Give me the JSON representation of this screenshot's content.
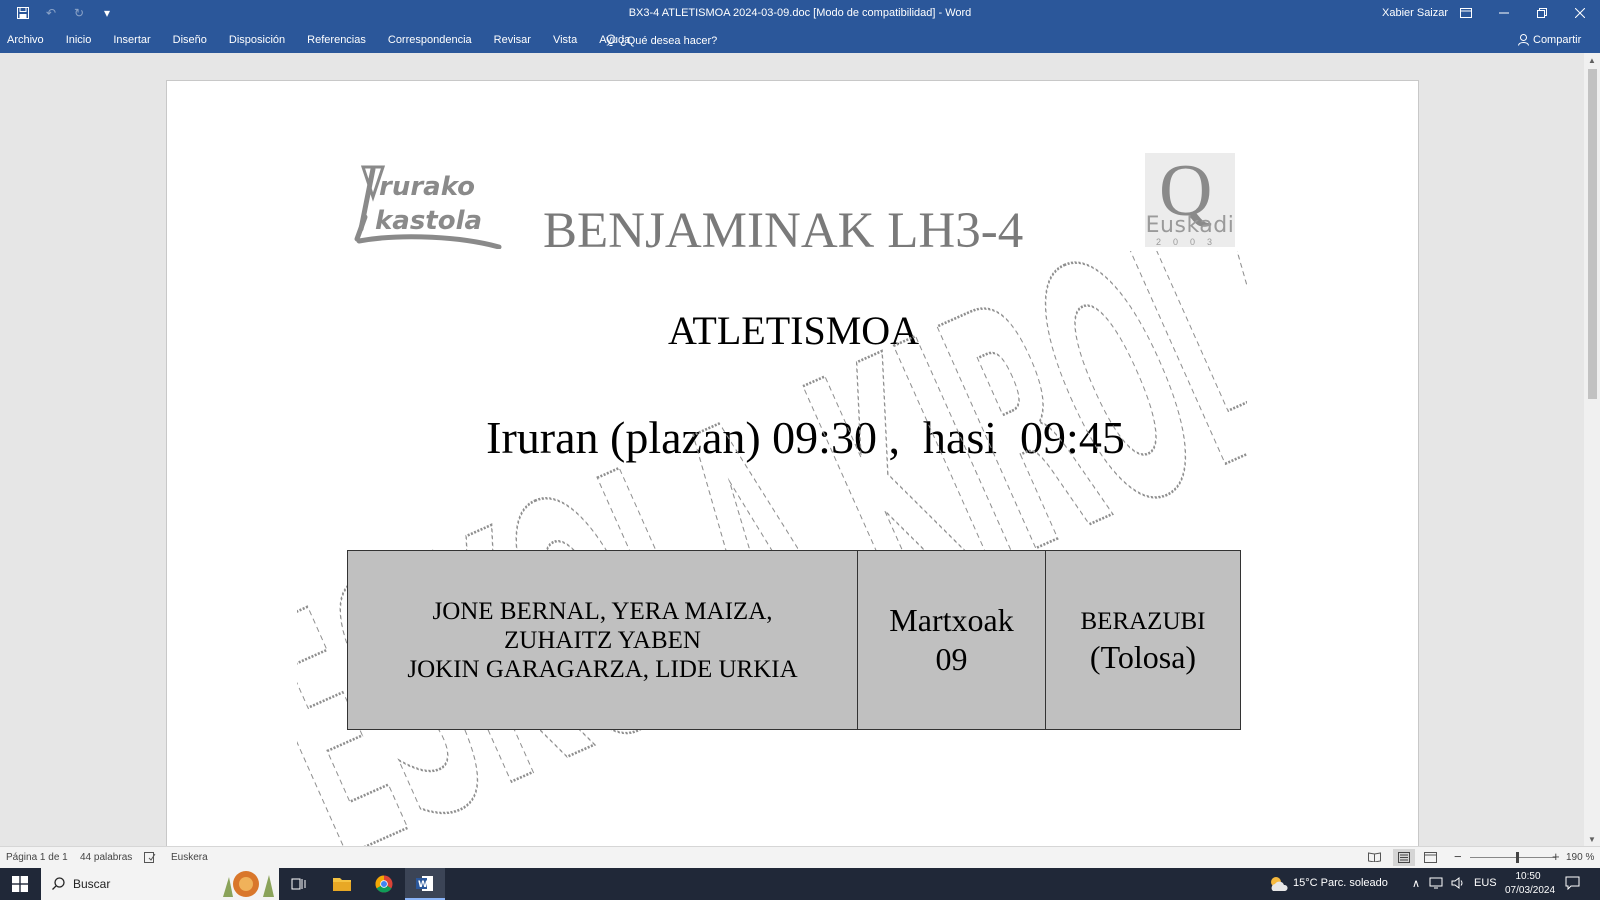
{
  "titlebar": {
    "title": "BX3-4 ATLETISMOA 2024-03-09.doc [Modo de compatibilidad]  -  Word",
    "user": "Xabier Saizar"
  },
  "ribbon": {
    "tabs": [
      "Archivo",
      "Inicio",
      "Insertar",
      "Diseño",
      "Disposición",
      "Referencias",
      "Correspondencia",
      "Revisar",
      "Vista",
      "Ayuda"
    ],
    "tell_me": "¿Qué desea hacer?",
    "share": "Compartir"
  },
  "document": {
    "logo_left": "Irurako Ikastola",
    "logo_right_name": "Euskadi",
    "logo_right_year": "2003",
    "heading1": "BENJAMINAK LH3-4",
    "heading2": "ATLETISMOA",
    "heading3": "Iruran (plazan) 09:30 ,  hasi  09:45",
    "watermark": "ESKOLA KIROLA",
    "table": {
      "names_line1": "JONE BERNAL, YERA MAIZA,",
      "names_line2": "ZUHAITZ YABEN",
      "names_line3": "JOKIN GARAGARZA, LIDE URKIA",
      "date_line1": "Martxoak",
      "date_line2": "09",
      "place_line1": "BERAZUBI",
      "place_line2": "(Tolosa)"
    }
  },
  "statusbar": {
    "page": "Página 1 de 1",
    "words": "44 palabras",
    "language": "Euskera",
    "zoom": "190 %"
  },
  "taskbar": {
    "search_placeholder": "Buscar",
    "weather": "15°C  Parc. soleado",
    "lang": "EUS",
    "time": "10:50",
    "date": "07/03/2024"
  },
  "colors": {
    "word_blue": "#2b579a",
    "table_gray": "#c0c0c0",
    "taskbar": "#202838"
  }
}
